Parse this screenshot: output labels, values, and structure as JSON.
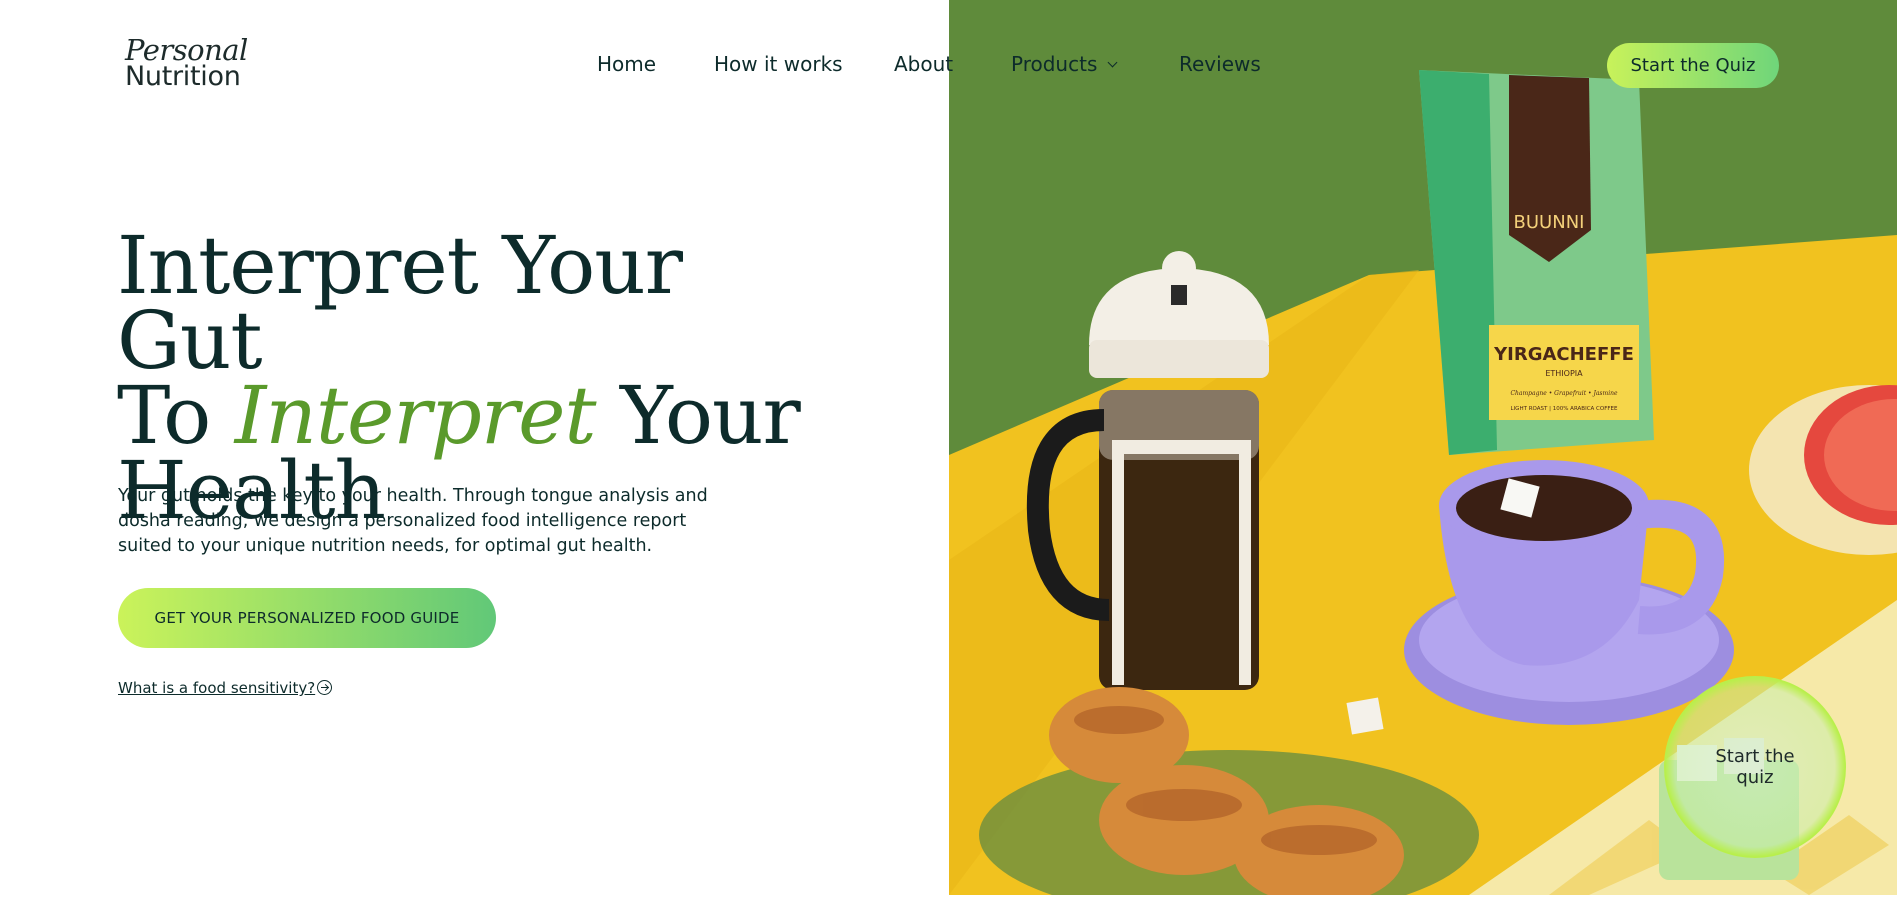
{
  "brand": {
    "logo_line1": "Personal",
    "logo_line2": "Nutrition"
  },
  "nav": {
    "items": [
      {
        "label": "Home"
      },
      {
        "label": "How it works"
      },
      {
        "label": "About"
      },
      {
        "label": "Products",
        "has_dropdown": true
      },
      {
        "label": "Reviews"
      }
    ],
    "cta_label": "Start the Quiz"
  },
  "hero": {
    "headline_line1": "Interpret Your Gut",
    "headline_line2_prefix": "To ",
    "headline_line2_accent": "Interpret",
    "headline_line2_suffix": " Your",
    "headline_line3": "Health",
    "subcopy": "Your gut holds the key to your health. Through tongue analysis and dosha reading, we design a personalized food intelligence report suited to your unique nutrition needs, for optimal gut health.",
    "cta_label": "GET YOUR PERSONALIZED FOOD GUIDE",
    "link_label": "What is a food sensitivity?",
    "link_icon": "arrow-circle-right-icon"
  },
  "photo": {
    "bag_brand": "BUUNNI",
    "bag_origin": "YIRGACHEFFE",
    "bag_country": "ETHIOPIA",
    "bag_notes": "Champagne • Grapefruit • Jasmine",
    "bag_roast": "LIGHT ROAST | 100% ARABICA COFFEE"
  },
  "floating_badge": {
    "label": "Start the quiz"
  },
  "colors": {
    "text": "#0d2b2b",
    "accent": "#5a9a2b",
    "gradient_start": "#c8f25a",
    "gradient_end": "#6fd57a",
    "photo_bg": "#5e8a3a"
  }
}
